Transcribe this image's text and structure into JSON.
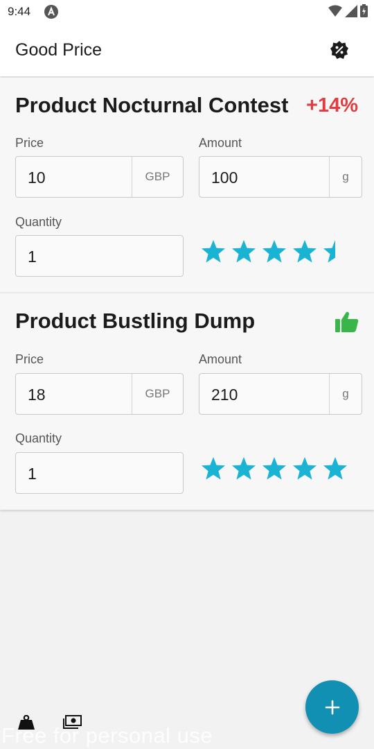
{
  "status_bar": {
    "time": "9:44"
  },
  "app_bar": {
    "title": "Good Price"
  },
  "products": [
    {
      "name": "Product Nocturnal Contest",
      "delta": "+14%",
      "price_label": "Price",
      "price_value": "10",
      "currency": "GBP",
      "amount_label": "Amount",
      "amount_value": "100",
      "unit": "g",
      "quantity_label": "Quantity",
      "quantity_value": "1",
      "rating": 4.5
    },
    {
      "name": "Product Bustling Dump",
      "badge_icon": "thumbs-up-icon",
      "price_label": "Price",
      "price_value": "18",
      "currency": "GBP",
      "amount_label": "Amount",
      "amount_value": "210",
      "unit": "g",
      "quantity_label": "Quantity",
      "quantity_value": "1",
      "rating": 5
    }
  ],
  "bottom_bar": {
    "icons": [
      "weight-icon",
      "money-icon"
    ]
  },
  "fab": {
    "icon": "plus-icon"
  },
  "watermark": "Free for personal use",
  "colors": {
    "accent": "#1290b3",
    "star": "#1ab3d4",
    "delta_negative": "#e33b3f",
    "thumb": "#3ab54a"
  }
}
